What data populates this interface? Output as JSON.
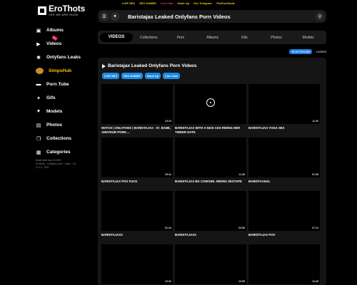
{
  "topbar": [
    {
      "label": "LIVE SEX",
      "red": false
    },
    {
      "label": "SEX GAMES",
      "red": false
    },
    {
      "label": "Live Cam",
      "red": true
    },
    {
      "label": "Hook Up",
      "red": false
    },
    {
      "label": "Our Telegram",
      "red": false
    },
    {
      "label": "ThePornDude",
      "red": false
    }
  ],
  "logo": {
    "title": "EroThots",
    "tagline": "YES WE ARE HUGE"
  },
  "nav": [
    {
      "label": "Albums",
      "icon": "images-icon",
      "glyph": "▣"
    },
    {
      "label": "Videos",
      "icon": "play-icon",
      "glyph": "▶"
    },
    {
      "label": "Onlyfans Leaks",
      "icon": "asterisk-icon",
      "glyph": "✱"
    },
    {
      "label": "SimpsHub",
      "icon": "simpshub-logo-icon",
      "glyph": ""
    },
    {
      "label": "Porn Tube",
      "icon": "film-icon",
      "glyph": "▬"
    },
    {
      "label": "Gifs",
      "icon": "gif-icon",
      "glyph": "✦"
    },
    {
      "label": "Models",
      "icon": "heart-icon",
      "glyph": "♥"
    },
    {
      "label": "Photos",
      "icon": "photo-icon",
      "glyph": "▤"
    },
    {
      "label": "Collections",
      "icon": "collections-icon",
      "glyph": "❐"
    },
    {
      "label": "Categories",
      "icon": "categories-icon",
      "glyph": "▦"
    }
  ],
  "footer_lines": [
    "Made with love ♥ 2025",
    "Erothots - Onlyfans porn - Nsfw - 18",
    "U.S.C. 2257"
  ],
  "header": {
    "title": "Baristajax Leaked Onlyfans Porn Videos"
  },
  "tabs": [
    "VIDEOS",
    "Collections",
    "Porn",
    "Albums",
    "Gifs",
    "Photos",
    "Models"
  ],
  "sort": {
    "active": "Most Results",
    "other": "Lastest"
  },
  "content": {
    "title": "Baristajax Leaked Onlyfans Porn Videos"
  },
  "tags": [
    "LIVE SEX",
    "SEX GAMES",
    "Hook Up",
    "Live Cam"
  ],
  "videos": [
    {
      "title": "WATCH | ONLYFANS | BARISTAJAX - 07. BABE, AMATEUR PORN ...",
      "duration": "24:24",
      "spinner": false
    },
    {
      "title": "BARISTAJAX WITH A NICE ASS RIDING HER TINDER DATE",
      "duration": "",
      "spinner": true
    },
    {
      "title": "BARISTAJAX YOGA SEX",
      "duration": "11:40",
      "spinner": false
    },
    {
      "title": "BARISTAJAX POV FUCK",
      "duration": "29:41",
      "spinner": false
    },
    {
      "title": "BARISTAJAX BG COWGIRL RIDING SEXTAPE",
      "duration": "11:38",
      "spinner": false
    },
    {
      "title": "BARISTAANAL",
      "duration": "01:08",
      "spinner": false
    },
    {
      "title": "BARISTAJAXX",
      "duration": "51:44",
      "spinner": false
    },
    {
      "title": "BARISTAJAXX",
      "duration": "03:56",
      "spinner": false
    },
    {
      "title": "BARISTAJAX POV",
      "duration": "07:12",
      "spinner": false
    },
    {
      "title": "BARISTAJAX CREAMPIE 2 HOLE",
      "duration": "10:32",
      "spinner": false
    },
    {
      "title": "BARISTAJAX 27",
      "duration": "10:55",
      "spinner": false
    },
    {
      "title": "BARISTAJAX NUDE FUCKING",
      "duration": "13:48",
      "spinner": false
    }
  ]
}
